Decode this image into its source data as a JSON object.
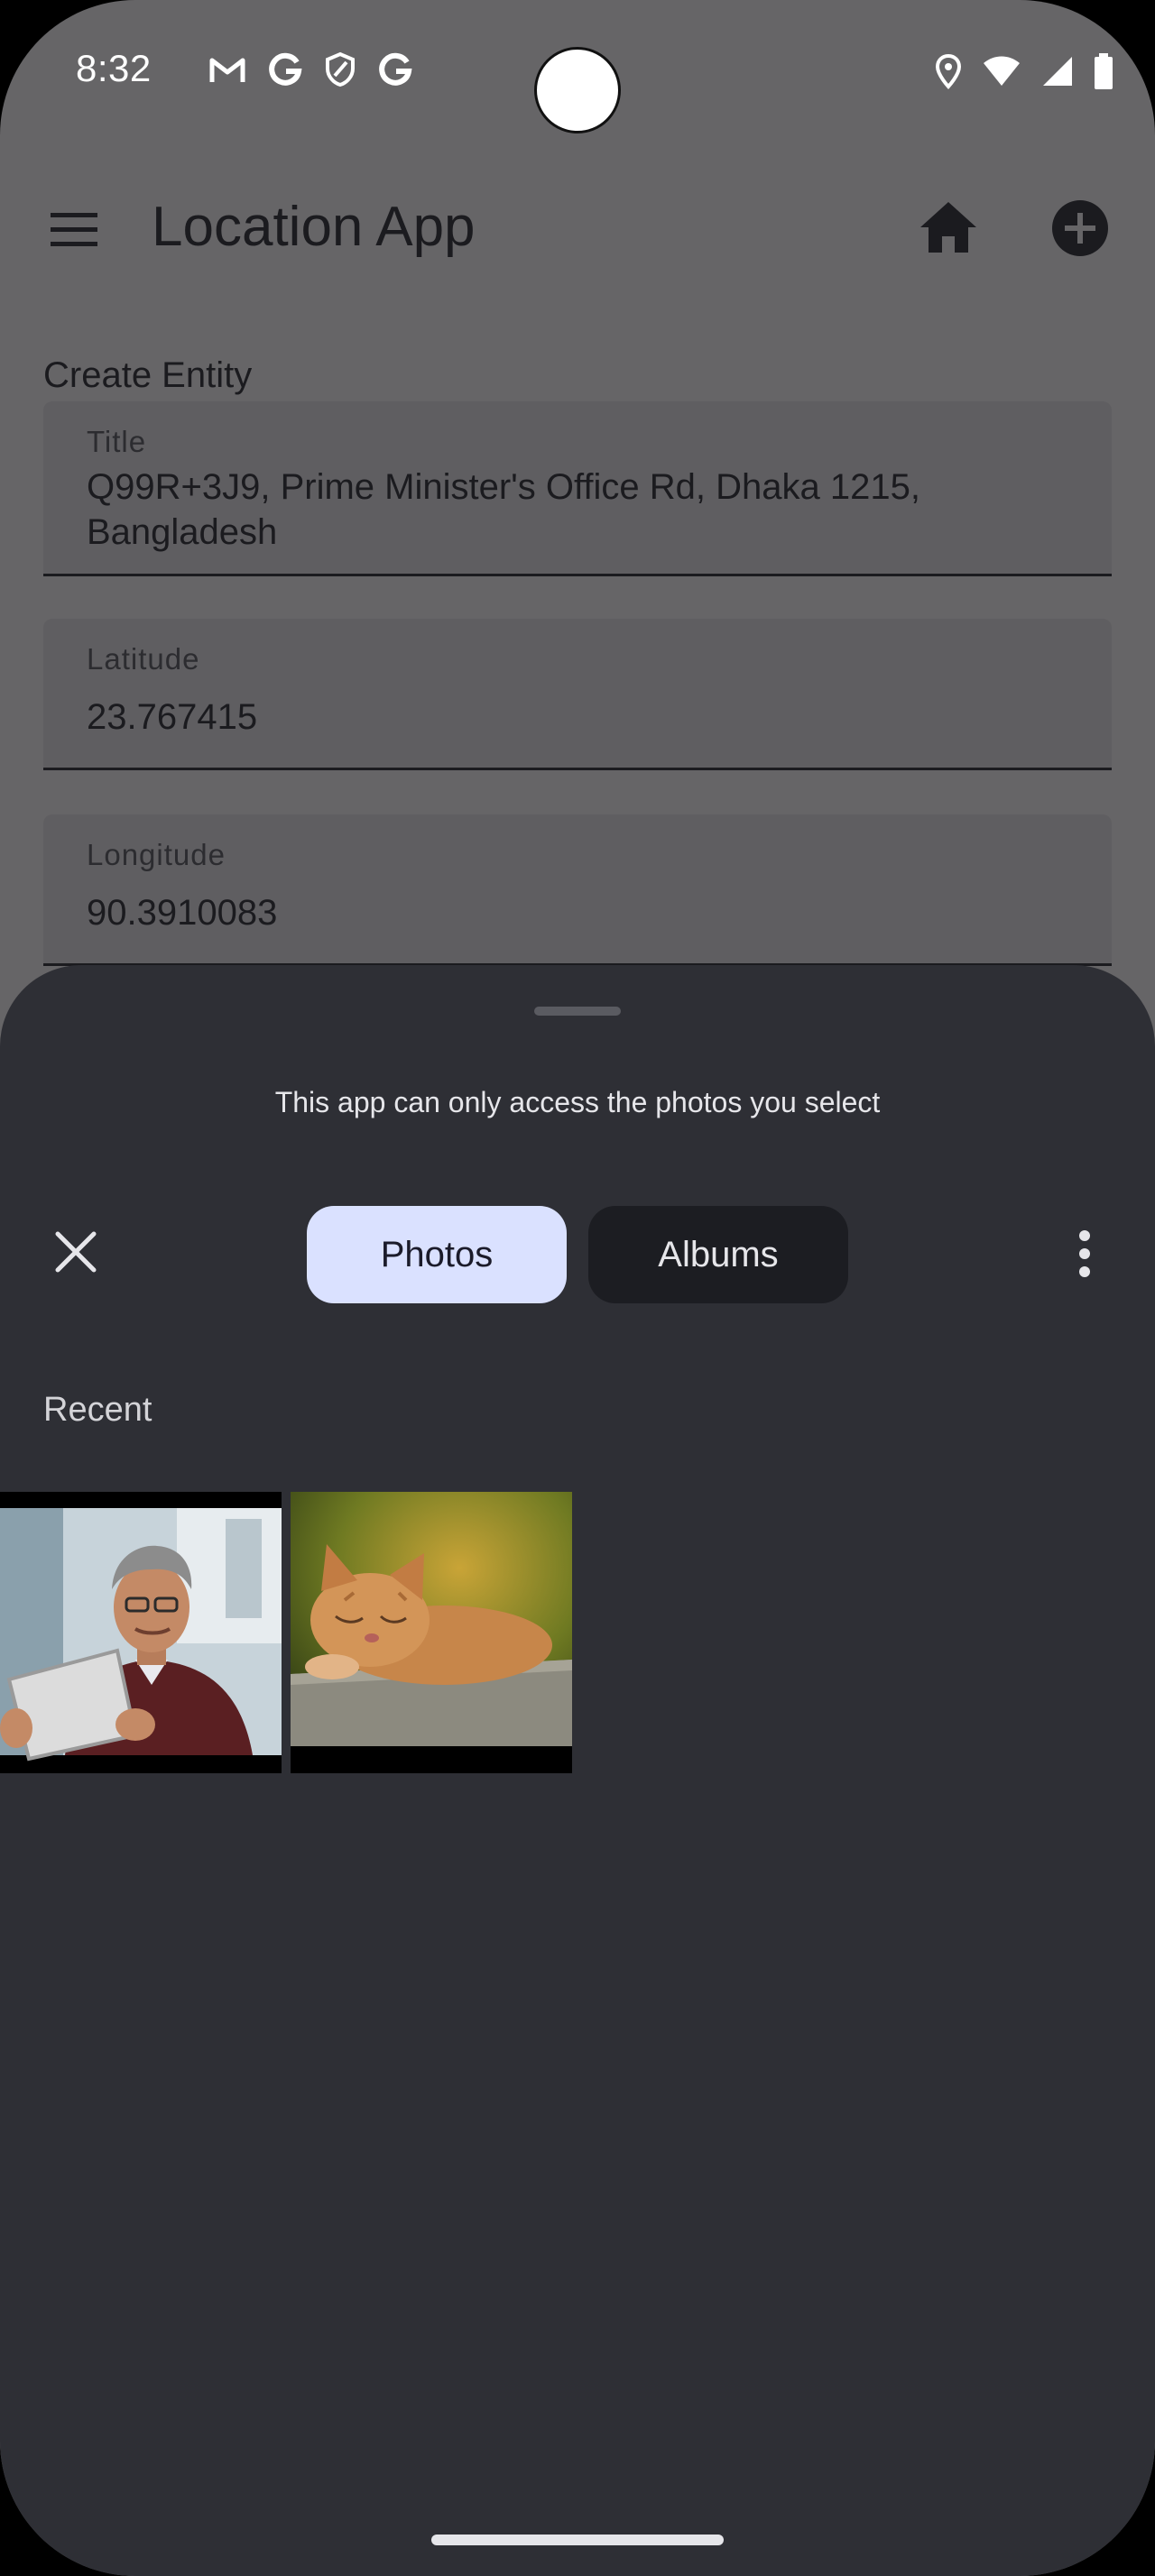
{
  "status_bar": {
    "time": "8:32",
    "left_icons": [
      "gmail-icon",
      "google-icon",
      "shield-icon",
      "google-icon"
    ],
    "right_icons": [
      "location-icon",
      "wifi-icon",
      "signal-icon",
      "battery-icon"
    ]
  },
  "app_bar": {
    "title": "Location App",
    "actions": [
      "menu-icon",
      "home-icon",
      "add-circle-icon"
    ]
  },
  "form": {
    "section_title": "Create Entity",
    "fields": [
      {
        "label": "Title",
        "value": "Q99R+3J9, Prime Minister's Office Rd, Dhaka 1215, Bangladesh"
      },
      {
        "label": "Latitude",
        "value": "23.767415"
      },
      {
        "label": "Longitude",
        "value": "90.3910083"
      }
    ]
  },
  "photo_picker": {
    "message": "This app can only access the photos you select",
    "tabs": [
      {
        "label": "Photos",
        "selected": true
      },
      {
        "label": "Albums",
        "selected": false
      }
    ],
    "section_label": "Recent",
    "photos": [
      {
        "subject": "man-with-tablet"
      },
      {
        "subject": "sleeping-cat"
      }
    ]
  },
  "colors": {
    "scrim_background": "#666567",
    "sheet_background": "#2e2f35",
    "selected_tab": "#dae1ff",
    "unselected_tab": "#1c1d22"
  }
}
